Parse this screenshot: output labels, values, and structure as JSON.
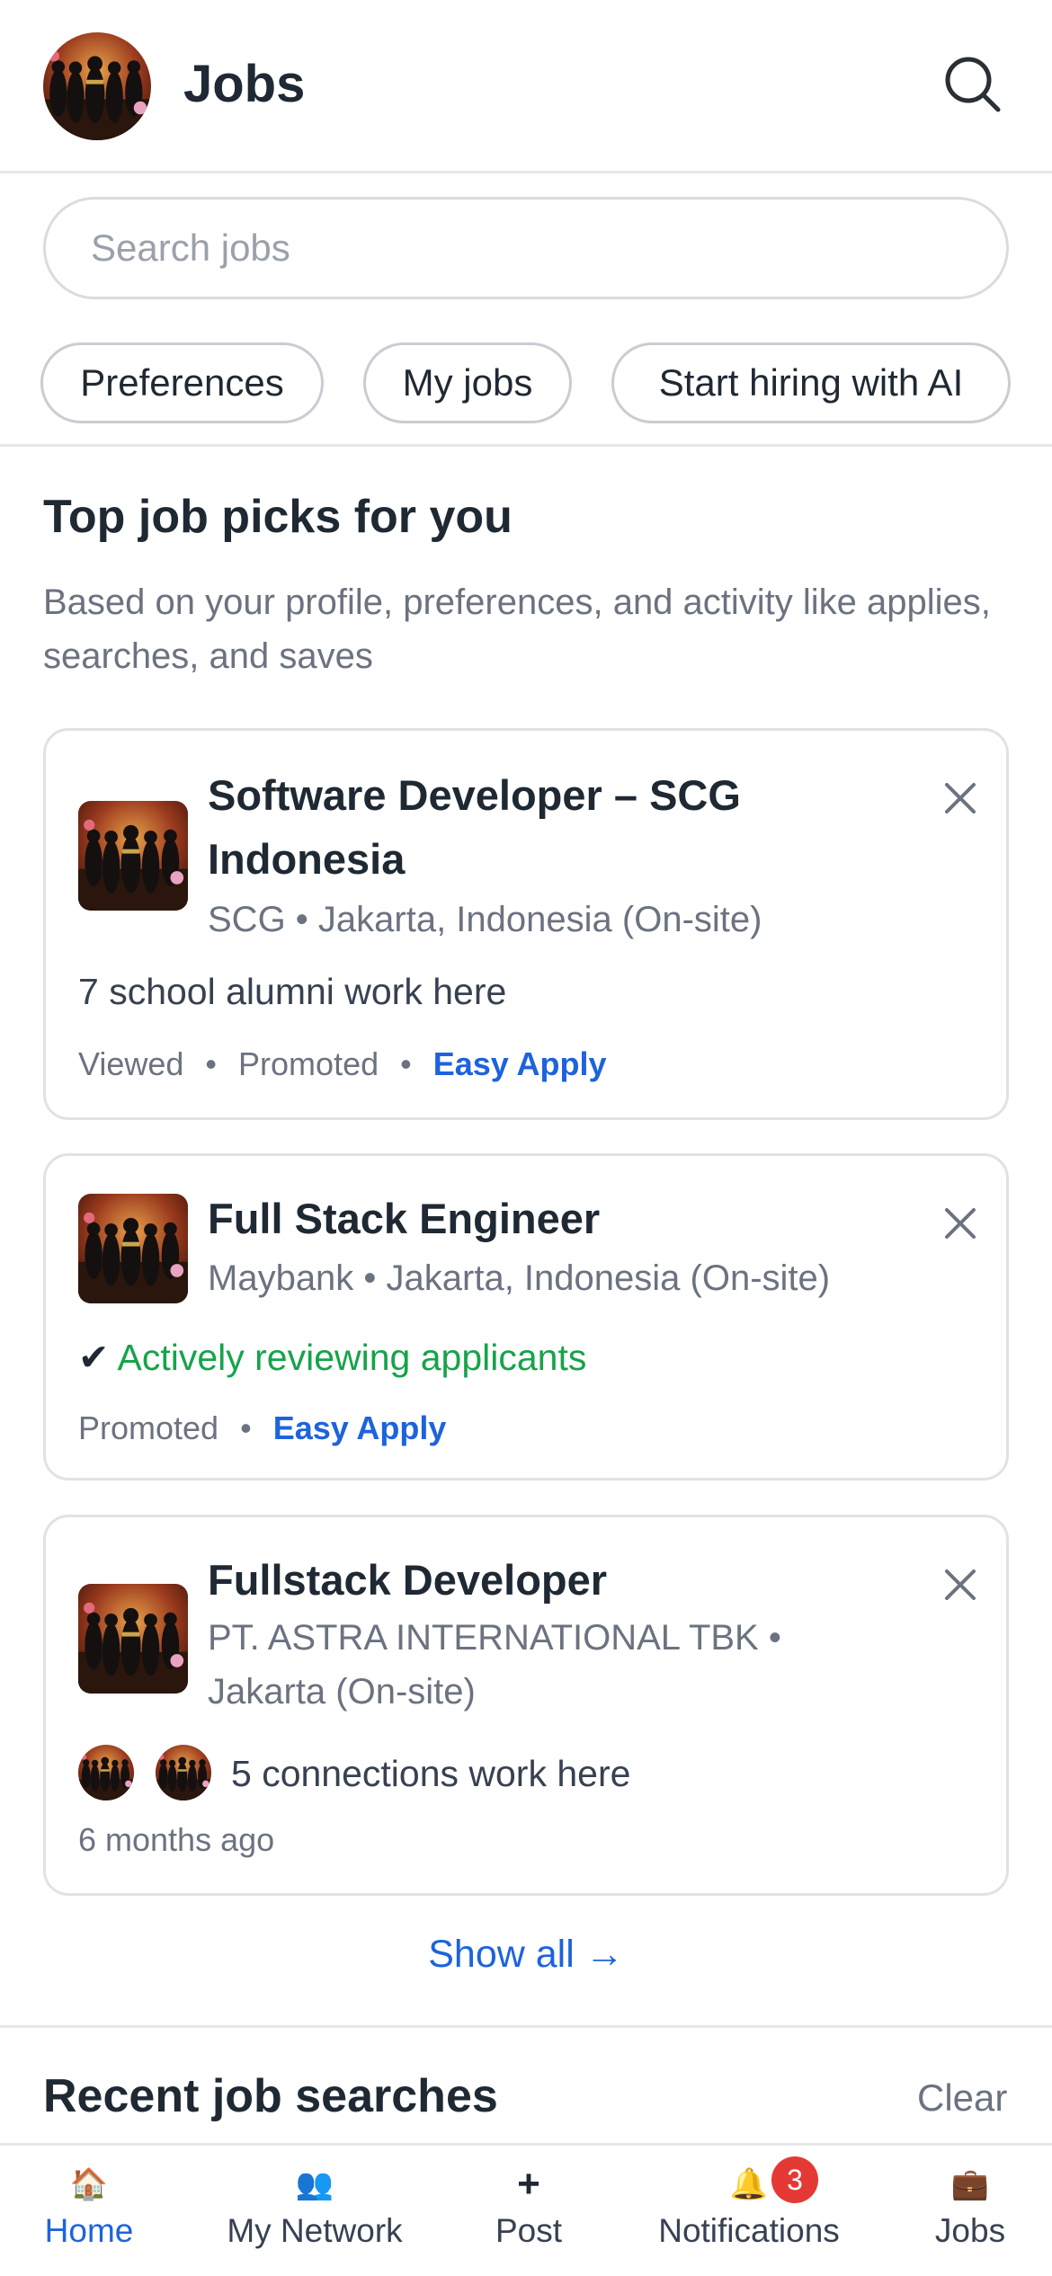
{
  "header": {
    "title": "Jobs",
    "search_icon": "search-icon"
  },
  "search": {
    "placeholder": "Search jobs"
  },
  "chips": [
    "Preferences",
    "My jobs",
    "Start hiring with AI"
  ],
  "top_picks": {
    "title": "Top job picks for you",
    "subtitle": "Based on your profile, preferences, and activity like applies, searches, and saves",
    "jobs": [
      {
        "title": "Software Developer – SCG Indonesia",
        "meta": "SCG • Jakarta, Indonesia (On-site)",
        "insight": "7 school alumni work here",
        "footer": [
          "Viewed",
          "Promoted",
          "Easy Apply"
        ]
      },
      {
        "title": "Full Stack Engineer",
        "meta": "Maybank • Jakarta, Indonesia (On-site)",
        "insight": "Actively reviewing applicants",
        "footer": [
          "Promoted",
          "Easy Apply"
        ]
      },
      {
        "title": "Fullstack Developer",
        "meta": "PT. ASTRA INTERNATIONAL TBK • Jakarta (On-site)",
        "insight": "5 connections work here",
        "footer": [
          "6 months ago"
        ]
      }
    ],
    "footer_separator": "•",
    "check_mark": "✔",
    "show_all": "Show all →"
  },
  "recent_searches": {
    "title": "Recent job searches",
    "clear": "Clear"
  },
  "bottom_nav": {
    "items": [
      {
        "label": "Home",
        "icon": "🏠",
        "active": true
      },
      {
        "label": "My Network",
        "icon": "👥"
      },
      {
        "label": "Post",
        "icon": "+"
      },
      {
        "label": "Notifications",
        "icon": "🔔",
        "badge": "3"
      },
      {
        "label": "Jobs",
        "icon": "💼"
      }
    ]
  },
  "colors": {
    "accent": "#1d63dc",
    "green": "#16a34a",
    "badge": "#e53935"
  }
}
